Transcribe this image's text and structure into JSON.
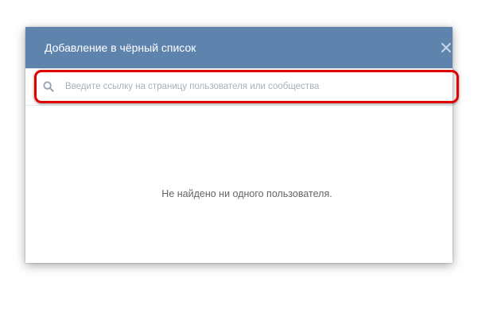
{
  "dialog": {
    "title": "Добавление в чёрный список",
    "close_icon": "close-icon",
    "header_color": "#5e84ae"
  },
  "search": {
    "icon": "search-icon",
    "placeholder": "Введите ссылку на страницу пользователя или сообщества",
    "value": ""
  },
  "empty_state": {
    "message": "Не найдено ни одного пользователя."
  },
  "highlight": {
    "color": "#e00000"
  }
}
